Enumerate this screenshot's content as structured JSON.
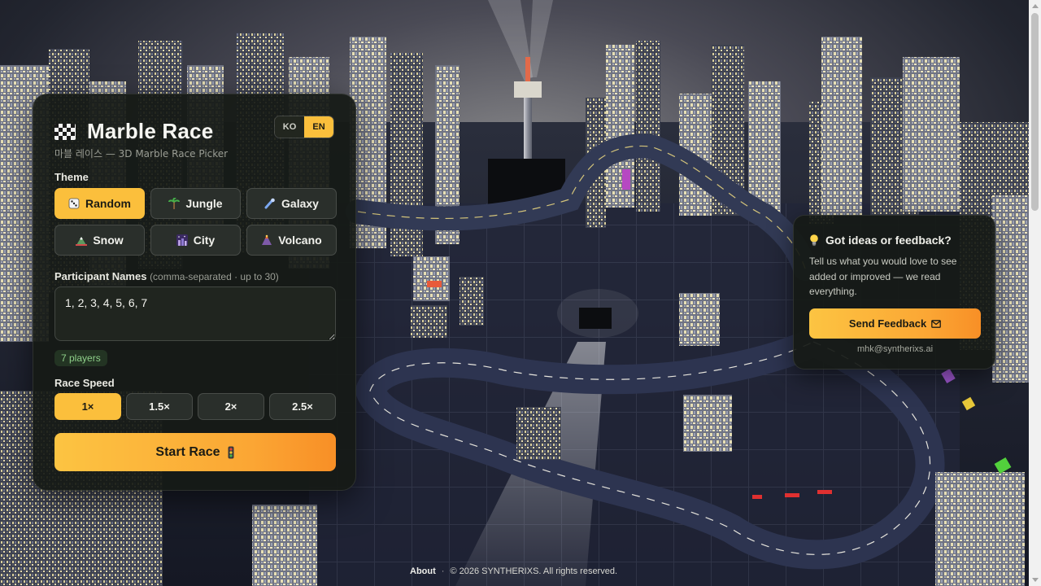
{
  "app": {
    "title": "Marble Race",
    "subtitle": "마블 레이스 — 3D Marble Race Picker",
    "lang_options": [
      "KO",
      "EN"
    ],
    "lang_selected": "EN"
  },
  "theme": {
    "label": "Theme",
    "selected": "Random",
    "options": [
      {
        "label": "Random",
        "icon": "dice-icon"
      },
      {
        "label": "Jungle",
        "icon": "palm-tree-icon"
      },
      {
        "label": "Galaxy",
        "icon": "comet-icon"
      },
      {
        "label": "Snow",
        "icon": "snow-mountain-icon"
      },
      {
        "label": "City",
        "icon": "city-night-icon"
      },
      {
        "label": "Volcano",
        "icon": "volcano-icon"
      }
    ]
  },
  "participants": {
    "label": "Participant Names",
    "hint": "(comma-separated · up to 30)",
    "value": "1, 2, 3, 4, 5, 6, 7",
    "count_badge": "7 players"
  },
  "speed": {
    "label": "Race Speed",
    "options": [
      "1×",
      "1.5×",
      "2×",
      "2.5×"
    ],
    "selected": "1×"
  },
  "start_button": {
    "label": "Start Race",
    "icon": "traffic-light-icon"
  },
  "feedback": {
    "title": "Got ideas or feedback?",
    "body": "Tell us what you would love to see added or improved — we read everything.",
    "button_label": "Send Feedback",
    "button_icon": "envelope-icon",
    "email": "mhk@syntherixs.ai"
  },
  "footer": {
    "about": "About",
    "separator": "·",
    "copyright": "© 2026 SYNTHERIXS. All rights reserved."
  },
  "colors": {
    "accent": "#fbbf3c",
    "accent_end": "#f88f26",
    "panel_bg": "#161a16",
    "badge_text": "#8fd08a"
  }
}
